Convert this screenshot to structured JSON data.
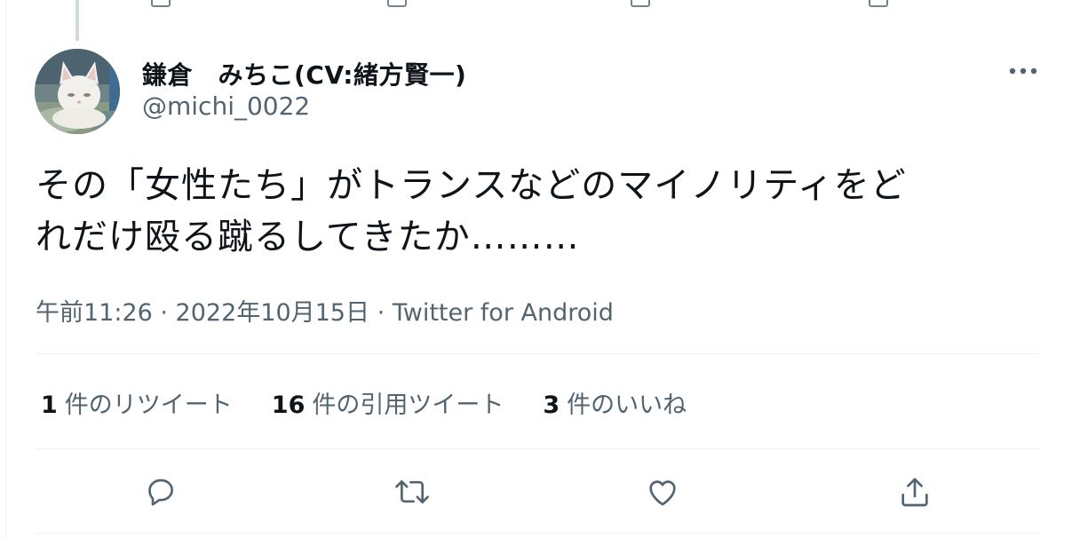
{
  "tweet": {
    "display_name": "鎌倉　みちこ(CV:緒方賢一)",
    "handle": "@michi_0022",
    "text_line1": "その「女性たち」がトランスなどのマイノリティをど",
    "text_line2": "れだけ殴る蹴るしてきたか………",
    "meta": "午前11:26 · 2022年10月15日 · Twitter for Android"
  },
  "stats": {
    "retweets_count": "1",
    "retweets_label": "件のリツイート",
    "quotes_count": "16",
    "quotes_label": "件の引用ツイート",
    "likes_count": "3",
    "likes_label": "件のいいね"
  },
  "icons": {
    "more": "more-dots-icon",
    "reply": "reply-icon",
    "retweet": "retweet-icon",
    "like": "heart-icon",
    "share": "share-icon",
    "avatar": "cat-avatar"
  },
  "colors": {
    "primary_text": "#0f1419",
    "secondary_text": "#536471",
    "divider": "#eff3f4",
    "thread_line": "#cfd9de"
  }
}
